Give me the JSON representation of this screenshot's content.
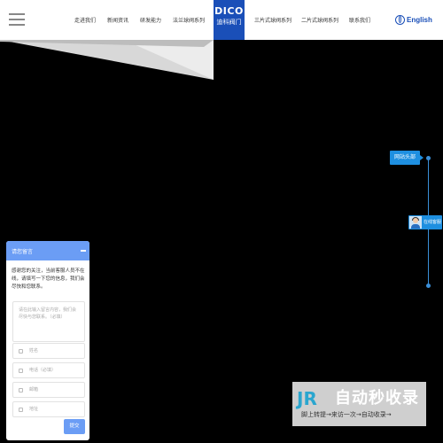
{
  "nav": {
    "items": [
      "走进我们",
      "新闻资讯",
      "研发能力",
      "法兰球阀系列",
      "三片式球阀系列",
      "二片式球阀系列",
      "联系我们"
    ],
    "logo_big": "DICO",
    "logo_small": "迪科阀门",
    "lang_label": "English"
  },
  "timeline": {
    "top_label": "网站头部",
    "service_label": "在线客服"
  },
  "chat": {
    "title": "请您留言",
    "message": "感谢您的关注，当前客服人员不在线，请填写一下您的信息，我们会尽快和您联系。",
    "textarea_placeholder": "请在此输入留言内容，我们会尽快与您联系。（必填）",
    "name_placeholder": "姓名",
    "phone_placeholder": "电话（必填）",
    "email_placeholder": "邮箱",
    "address_placeholder": "地址",
    "submit_label": "提交"
  },
  "watermark": {
    "logo": "JR",
    "text": "自动秒收录",
    "sub": "脚上转提→来访一次→自动收录→"
  },
  "colors": {
    "accent": "#1e8fe0",
    "chat_header": "#6b9df5",
    "logo_bg": "#1a4fb8"
  }
}
